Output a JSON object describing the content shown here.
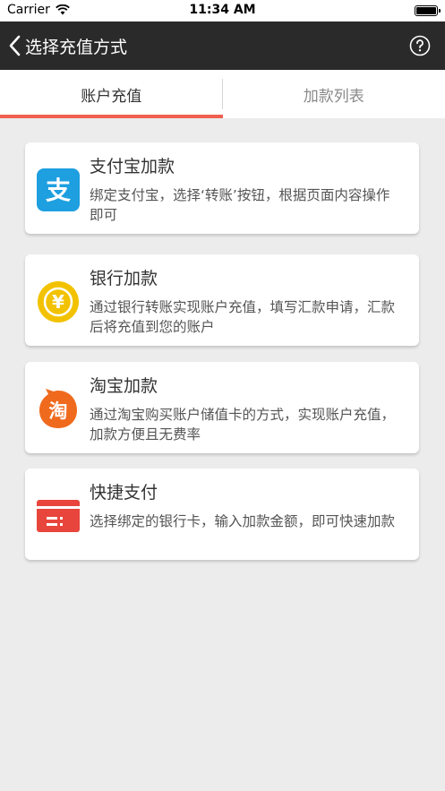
{
  "status_bar": {
    "carrier": "Carrier",
    "time": "11:34 AM"
  },
  "nav": {
    "title": "选择充值方式"
  },
  "tabs": [
    {
      "label": "账户充值",
      "active": true
    },
    {
      "label": "加款列表",
      "active": false
    }
  ],
  "methods": [
    {
      "title": "支付宝加款",
      "desc": "绑定支付宝，选择‘转账’按钮，根据页面内容操作即可",
      "icon": "alipay-icon"
    },
    {
      "title": "银行加款",
      "desc": "通过银行转账实现账户充值，填写汇款申请，汇款后将充值到您的账户",
      "icon": "yen-coin-icon"
    },
    {
      "title": "淘宝加款",
      "desc": "通过淘宝购买账户储值卡的方式，实现账户充值，加款方便且无费率",
      "icon": "taobao-icon"
    },
    {
      "title": "快捷支付",
      "desc": "选择绑定的银行卡，输入加款金额，即可快速加款",
      "icon": "bank-card-icon"
    }
  ],
  "icon_glyphs": {
    "alipay": "支",
    "yen": "¥",
    "taobao": "淘"
  },
  "colors": {
    "accent": "#f0604f",
    "nav_bg": "#2a2a2a",
    "alipay_blue": "#1e9fe0",
    "coin_yellow": "#f2c200",
    "taobao_orange": "#f06a1d",
    "card_red": "#e8453c"
  }
}
